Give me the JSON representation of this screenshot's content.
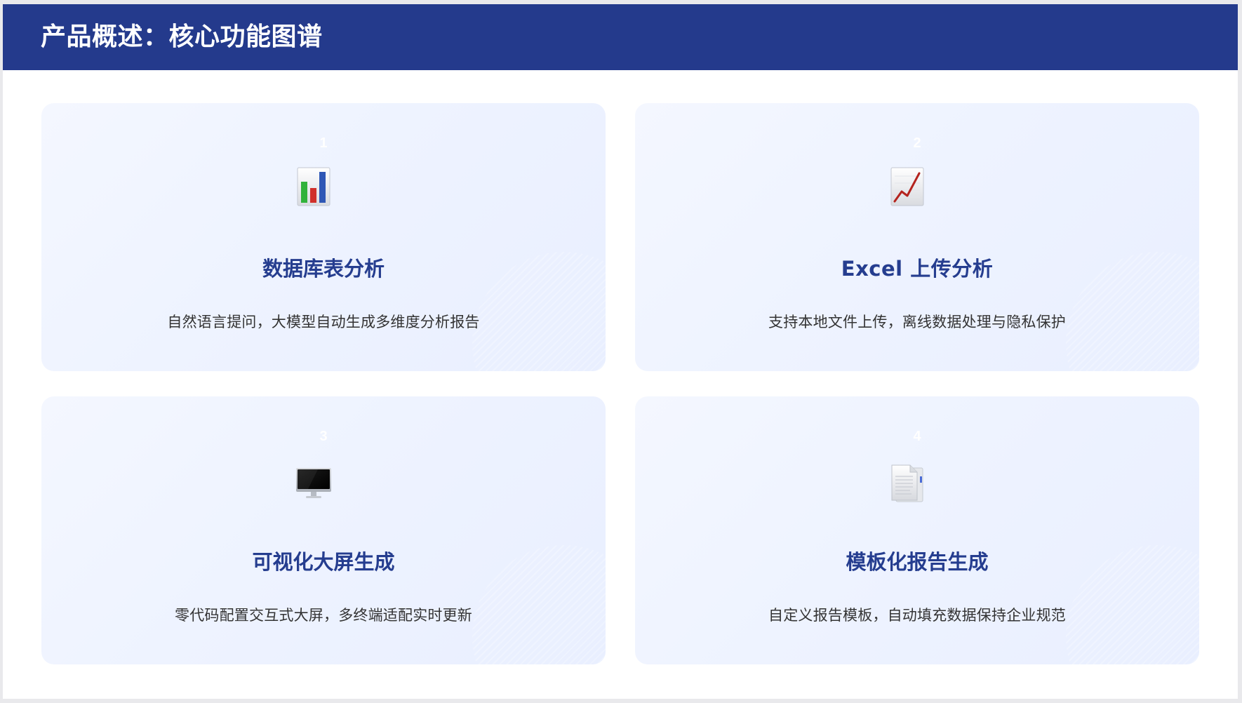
{
  "header": {
    "title": "产品概述：核心功能图谱"
  },
  "cards": [
    {
      "number": "1",
      "icon": "bar-chart-icon",
      "title": "数据库表分析",
      "description": "自然语言提问，大模型自动生成多维度分析报告"
    },
    {
      "number": "2",
      "icon": "line-chart-icon",
      "title": "Excel 上传分析",
      "description": "支持本地文件上传，离线数据处理与隐私保护"
    },
    {
      "number": "3",
      "icon": "monitor-icon",
      "title": "可视化大屏生成",
      "description": "零代码配置交互式大屏，多终端适配实时更新"
    },
    {
      "number": "4",
      "icon": "document-icon",
      "title": "模板化报告生成",
      "description": "自定义报告模板，自动填充数据保持企业规范"
    }
  ],
  "colors": {
    "header_bg": "#243a8c",
    "title_text": "#253d8f",
    "card_bg": "#eef3ff"
  }
}
